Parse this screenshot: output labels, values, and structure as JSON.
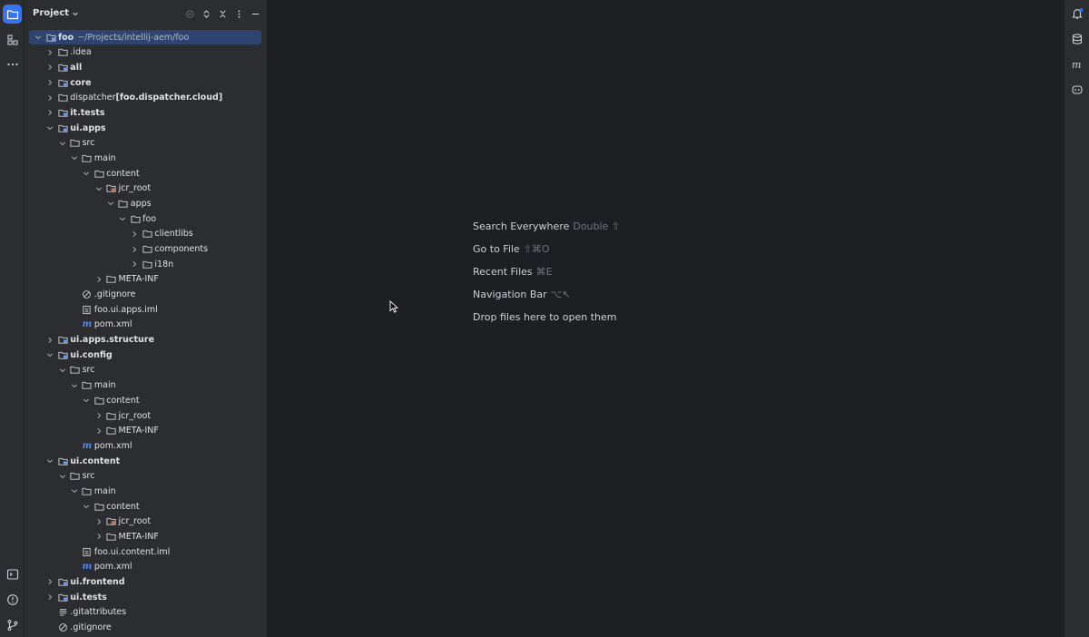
{
  "panel": {
    "title": "Project"
  },
  "tree": [
    {
      "depth": 0,
      "label": "foo",
      "sub": "~/Projects/intellij-aem/foo",
      "bold": true,
      "expanded": true,
      "kind": "module",
      "selected": true
    },
    {
      "depth": 1,
      "label": ".idea",
      "bold": false,
      "expanded": false,
      "kind": "folder"
    },
    {
      "depth": 1,
      "label": "all",
      "bold": true,
      "expanded": false,
      "kind": "module"
    },
    {
      "depth": 1,
      "label": "core",
      "bold": true,
      "expanded": false,
      "kind": "module"
    },
    {
      "depth": 1,
      "label": "dispatcher ",
      "extra": "[foo.dispatcher.cloud]",
      "bold": false,
      "expanded": false,
      "kind": "folder"
    },
    {
      "depth": 1,
      "label": "it.tests",
      "bold": true,
      "expanded": false,
      "kind": "module"
    },
    {
      "depth": 1,
      "label": "ui.apps",
      "bold": true,
      "expanded": true,
      "kind": "module"
    },
    {
      "depth": 2,
      "label": "src",
      "bold": false,
      "expanded": true,
      "kind": "folder"
    },
    {
      "depth": 3,
      "label": "main",
      "bold": false,
      "expanded": true,
      "kind": "folder"
    },
    {
      "depth": 4,
      "label": "content",
      "bold": false,
      "expanded": true,
      "kind": "folder"
    },
    {
      "depth": 5,
      "label": "jcr_root",
      "bold": false,
      "expanded": true,
      "kind": "jcr"
    },
    {
      "depth": 6,
      "label": "apps",
      "bold": false,
      "expanded": true,
      "kind": "folder"
    },
    {
      "depth": 7,
      "label": "foo",
      "bold": false,
      "expanded": true,
      "kind": "folder"
    },
    {
      "depth": 8,
      "label": "clientlibs",
      "bold": false,
      "expanded": false,
      "kind": "folder"
    },
    {
      "depth": 8,
      "label": "components",
      "bold": false,
      "expanded": false,
      "kind": "folder"
    },
    {
      "depth": 8,
      "label": "i18n",
      "bold": false,
      "expanded": false,
      "kind": "folder"
    },
    {
      "depth": 5,
      "label": "META-INF",
      "bold": false,
      "expanded": false,
      "kind": "folder"
    },
    {
      "depth": 3,
      "label": ".gitignore",
      "bold": false,
      "kind": "ignore"
    },
    {
      "depth": 3,
      "label": "foo.ui.apps.iml",
      "bold": false,
      "kind": "iml"
    },
    {
      "depth": 3,
      "label": "pom.xml",
      "bold": false,
      "kind": "maven"
    },
    {
      "depth": 1,
      "label": "ui.apps.structure",
      "bold": true,
      "expanded": false,
      "kind": "module"
    },
    {
      "depth": 1,
      "label": "ui.config",
      "bold": true,
      "expanded": true,
      "kind": "module"
    },
    {
      "depth": 2,
      "label": "src",
      "bold": false,
      "expanded": true,
      "kind": "folder"
    },
    {
      "depth": 3,
      "label": "main",
      "bold": false,
      "expanded": true,
      "kind": "folder"
    },
    {
      "depth": 4,
      "label": "content",
      "bold": false,
      "expanded": true,
      "kind": "folder"
    },
    {
      "depth": 5,
      "label": "jcr_root",
      "bold": false,
      "expanded": false,
      "kind": "folder"
    },
    {
      "depth": 5,
      "label": "META-INF",
      "bold": false,
      "expanded": false,
      "kind": "folder"
    },
    {
      "depth": 3,
      "label": "pom.xml",
      "bold": false,
      "kind": "maven"
    },
    {
      "depth": 1,
      "label": "ui.content",
      "bold": true,
      "expanded": true,
      "kind": "module"
    },
    {
      "depth": 2,
      "label": "src",
      "bold": false,
      "expanded": true,
      "kind": "folder"
    },
    {
      "depth": 3,
      "label": "main",
      "bold": false,
      "expanded": true,
      "kind": "folder"
    },
    {
      "depth": 4,
      "label": "content",
      "bold": false,
      "expanded": true,
      "kind": "folder"
    },
    {
      "depth": 5,
      "label": "jcr_root",
      "bold": false,
      "expanded": false,
      "kind": "jcr"
    },
    {
      "depth": 5,
      "label": "META-INF",
      "bold": false,
      "expanded": false,
      "kind": "folder"
    },
    {
      "depth": 3,
      "label": "foo.ui.content.iml",
      "bold": false,
      "kind": "iml"
    },
    {
      "depth": 3,
      "label": "pom.xml",
      "bold": false,
      "kind": "maven"
    },
    {
      "depth": 1,
      "label": "ui.frontend",
      "bold": true,
      "expanded": false,
      "kind": "module"
    },
    {
      "depth": 1,
      "label": "ui.tests",
      "bold": true,
      "expanded": false,
      "kind": "module"
    },
    {
      "depth": 1,
      "label": ".gitattributes",
      "bold": false,
      "kind": "text"
    },
    {
      "depth": 1,
      "label": ".gitignore",
      "bold": false,
      "kind": "ignore"
    }
  ],
  "editor": {
    "hints": [
      {
        "label": "Search Everywhere",
        "key": "Double ⇧"
      },
      {
        "label": "Go to File",
        "key": "⇧⌘O"
      },
      {
        "label": "Recent Files",
        "key": "⌘E"
      },
      {
        "label": "Navigation Bar",
        "key": "⌥↖"
      },
      {
        "label": "Drop files here to open them",
        "key": ""
      }
    ]
  },
  "icons": {
    "left": [
      "project-icon",
      "structure-icon",
      "more-icon",
      "terminal-icon",
      "problems-icon",
      "git-icon"
    ],
    "right": [
      "notifications-icon",
      "database-icon",
      "maven-icon",
      "copilot-icon"
    ]
  },
  "colors": {
    "accent": "#3574f0",
    "selection": "#2e436e",
    "module_folder": "#6e9bf5",
    "maven": "#548af7"
  }
}
